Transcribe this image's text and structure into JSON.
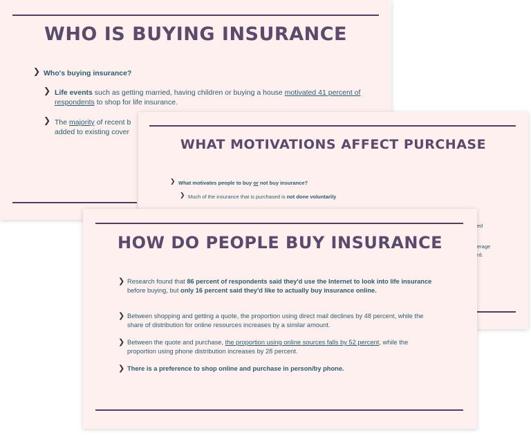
{
  "slide1": {
    "title": "WHO IS BUYING INSURANCE",
    "bullet_top": "Who's buying insurance?",
    "b1_bold": "Life events",
    "b1_text1": " such as getting married, having children or buying a house ",
    "b1_link": "motivated 41 percent of respondents",
    "b1_text2": " to shop for life insurance.",
    "b2_text1": "The ",
    "b2_link": "majority",
    "b2_text2": " of recent b",
    "b2_line2": "added to existing cover"
  },
  "slide2": {
    "title": "WHAT MOTIVATIONS AFFECT PURCHASE",
    "q_text1": "What motivates people to buy ",
    "q_or": "or",
    "q_text2": " not buy insurance?",
    "sub_text": "Much of the insurance that is purchased is ",
    "sub_bold": "not done voluntarily",
    "frag1": "ed",
    "frag2": "erage",
    "frag3": "rd."
  },
  "slide3": {
    "title": "HOW DO PEOPLE BUY INSURANCE",
    "b1_text1": "Research found that ",
    "b1_bold1": "86 percent of respondents said they'd use the Internet to look into life insurance",
    "b1_text2": " before buying, but ",
    "b1_bold2": "only 16 percent said they'd like to actually buy insurance online.",
    "b2_text": "Between shopping and getting a quote, the proportion using direct mail declines by 48 percent, while the share of distribution for online resources increases by a similar amount.",
    "b3_text1": "Between the quote and purchase, ",
    "b3_link": "the proportion using online sources falls by 52 percent",
    "b3_text2": ", while the proportion using phone distribution increases by 28 percent.",
    "b4_bold": "There is a preference to shop online and purchase in person/by phone."
  },
  "colors": {
    "slide_bg": "#fdf0ee",
    "title": "#5a4a6b",
    "body": "#2a5d6e",
    "rule": "#4f3f5e"
  }
}
